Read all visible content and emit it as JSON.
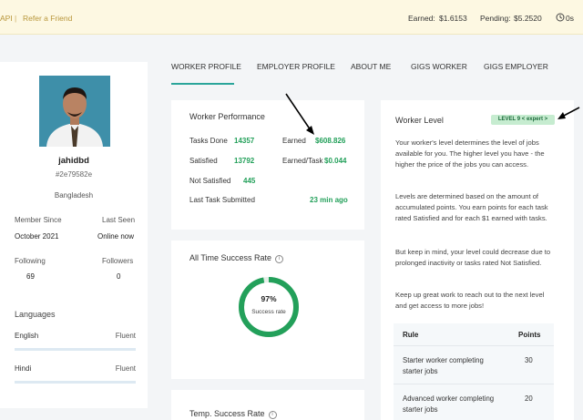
{
  "topbar": {
    "api_label": "API",
    "separator": "|",
    "refer_label": "Refer a Friend",
    "earned_label": "Earned:",
    "earned_value": "$1.6153",
    "pending_label": "Pending:",
    "pending_value": "$5.2520",
    "timer_icon": "clock-icon",
    "timer_value": "0s"
  },
  "profile": {
    "name": "jahidbd",
    "id": "#2e79582e",
    "country": "Bangladesh",
    "member_since_label": "Member Since",
    "member_since_value": "October 2021",
    "last_seen_label": "Last Seen",
    "last_seen_value": "Online now",
    "following_label": "Following",
    "following_value": "69",
    "followers_label": "Followers",
    "followers_value": "0",
    "languages_label": "Languages",
    "languages": [
      {
        "name": "English",
        "level": "Fluent"
      },
      {
        "name": "Hindi",
        "level": "Fluent"
      }
    ]
  },
  "tabs": [
    {
      "label": "WORKER PROFILE",
      "active": true
    },
    {
      "label": "EMPLOYER PROFILE"
    },
    {
      "label": "ABOUT ME"
    },
    {
      "label": "GIGS WORKER"
    },
    {
      "label": "GIGS EMPLOYER"
    }
  ],
  "performance": {
    "title": "Worker Performance",
    "tasks_done_label": "Tasks Done",
    "tasks_done_value": "14357",
    "earned_label": "Earned",
    "earned_value": "$608.826",
    "satisfied_label": "Satisfied",
    "satisfied_value": "13792",
    "earned_task_label": "Earned/Task",
    "earned_task_value": "$0.044",
    "not_satisfied_label": "Not Satisfied",
    "not_satisfied_value": "445",
    "last_task_label": "Last Task Submitted",
    "last_task_value": "23 min ago"
  },
  "success": {
    "title": "All Time Success Rate",
    "info_glyph": "i",
    "percent_text": "97%",
    "percent_value": 97,
    "caption": "Success rate",
    "ring_color": "#23a05a"
  },
  "temp_success": {
    "title": "Temp. Success Rate",
    "info_glyph": "i"
  },
  "level": {
    "title": "Worker Level",
    "badge": "LEVEL 9 < expert >",
    "para1": "Your worker's level determines the level of jobs available for you. The higher level you have - the higher the price of the jobs you can access.",
    "para2": "Levels are determined based on the amount of accumulated points. You earn points for each task rated Satisfied and for each $1 earned with tasks.",
    "para3": "But keep in mind, your level could decrease due to prolonged inactivity or tasks rated Not Satisfied.",
    "para4": "Keep up great work to reach out to the next level and get access to more jobs!",
    "table": {
      "rule_header": "Rule",
      "points_header": "Points",
      "rows": [
        {
          "rule": "Starter worker completing starter jobs",
          "points": "30"
        },
        {
          "rule": "Advanced worker completing starter jobs",
          "points": "20"
        }
      ]
    }
  },
  "colors": {
    "accent_green": "#23a05a",
    "tab_underline": "#2aa59a",
    "topbar_bg": "#fdf8e2",
    "badge_bg": "#c6ecd0"
  }
}
